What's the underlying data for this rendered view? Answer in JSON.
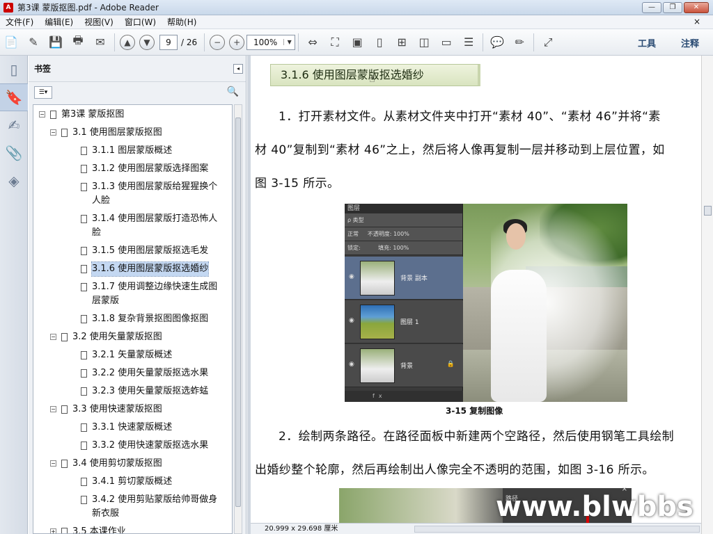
{
  "window": {
    "title": "第3课 蒙版抠图.pdf - Adobe Reader",
    "app_icon": "A"
  },
  "window_buttons": {
    "minimize": "—",
    "maximize": "❐",
    "close": "✕"
  },
  "menu": {
    "items": [
      "文件(F)",
      "编辑(E)",
      "视图(V)",
      "窗口(W)",
      "帮助(H)"
    ],
    "close": "×"
  },
  "toolbar": {
    "page_current": "9",
    "page_total": "/ 26",
    "zoom": "100%",
    "tools_label": "工具",
    "comment_label": "注释"
  },
  "bookmarks": {
    "title": "书签",
    "tree": [
      {
        "label": "第3课 蒙版抠图",
        "level": 0,
        "expander": "−"
      },
      {
        "label": "3.1 使用图层蒙版抠图",
        "level": 1,
        "expander": "−"
      },
      {
        "label": "3.1.1  图层蒙版概述",
        "level": 2
      },
      {
        "label": "3.1.2  使用图层蒙版选择图案",
        "level": 2
      },
      {
        "label": "3.1.3  使用图层蒙版给猩猩换个",
        "label2": "人脸",
        "level": 2
      },
      {
        "label": "3.1.4  使用图层蒙版打造恐怖人",
        "label2": "脸",
        "level": 2
      },
      {
        "label": "3.1.5  使用图层蒙版抠选毛发",
        "level": 2
      },
      {
        "label": "3.1.6  使用图层蒙版抠选婚纱",
        "level": 2,
        "selected": true
      },
      {
        "label": "3.1.7  使用调整边缘快速生成图",
        "label2": "层蒙版",
        "level": 2
      },
      {
        "label": "3.1.8  复杂背景抠图图像抠图",
        "level": 2
      },
      {
        "label": "3.2 使用矢量蒙版抠图",
        "level": 1,
        "expander": "−"
      },
      {
        "label": "3.2.1  矢量蒙版概述",
        "level": 2
      },
      {
        "label": "3.2.2  使用矢量蒙版抠选水果",
        "level": 2
      },
      {
        "label": "3.2.3  使用矢量蒙版抠选蚱蜢",
        "level": 2
      },
      {
        "label": "3.3 使用快速蒙版抠图",
        "level": 1,
        "expander": "−"
      },
      {
        "label": "3.3.1  快速蒙版概述",
        "level": 2
      },
      {
        "label": "3.3.2  使用快速蒙版抠选水果",
        "level": 2
      },
      {
        "label": "3.4 使用剪切蒙版抠图",
        "level": 1,
        "expander": "−"
      },
      {
        "label": "3.4.1  剪切蒙版概述",
        "level": 2
      },
      {
        "label": "3.4.2  使用剪贴蒙版给帅哥做身",
        "label2": "新衣服",
        "level": 2
      },
      {
        "label": "3.5 本课作业",
        "level": 1,
        "expander": "+"
      }
    ]
  },
  "document": {
    "section_heading": "3.1.6   使用图层蒙版抠选婚纱",
    "para1_line1": "1．打开素材文件。从素材文件夹中打开“素材 40”、“素材 46”并将“素",
    "para1_line2": "材 40”复制到“素材 46”之上，然后将人像再复制一层并移动到上层位置，如",
    "para1_line3": "图 3-15 所示。",
    "figure1": {
      "panel_tab": "图层",
      "filter_kind": "类型",
      "blend_mode": "正常",
      "opacity_label": "不透明度:",
      "opacity_value": "100%",
      "lock_label": "锁定:",
      "fill_label": "填充:",
      "fill_value": "100%",
      "layers": [
        {
          "name": "背景 副本",
          "selected": true
        },
        {
          "name": "图层 1",
          "selected": false
        },
        {
          "name": "背景",
          "selected": false,
          "locked": true
        }
      ],
      "footer_icons": "fx"
    },
    "figure1_caption": "3-15    复制图像",
    "para2_line1": "2．绘制两条路径。在路径面板中新建两个空路径，然后使用钢笔工具绘制",
    "para2_line2": "出婚纱整个轮廓，然后再绘制出人像完全不透明的范围，如图 3-16 所示。",
    "figure2": {
      "panel_tab": "路径",
      "close": "×"
    },
    "watermark": "www.blwbbs"
  },
  "statusbar": {
    "dims": "20.999 x 29.698 厘米"
  },
  "colors": {
    "selected_bookmark": "#c4d8f2",
    "section_bg": "#d9e4c0",
    "close_red": "#c9523d"
  }
}
